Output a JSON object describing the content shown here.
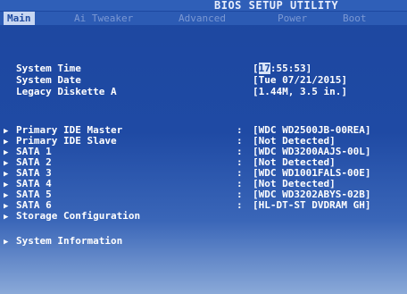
{
  "header": {
    "title": "BIOS SETUP UTILITY"
  },
  "menu": [
    {
      "label": "Main",
      "active": true
    },
    {
      "label": "Ai Tweaker",
      "active": false
    },
    {
      "label": "Advanced",
      "active": false
    },
    {
      "label": "Power",
      "active": false
    },
    {
      "label": "Boot",
      "active": false
    }
  ],
  "system": {
    "time_label": "System Time",
    "time_open": "[",
    "time_cursor": "17",
    "time_rest": ":55:53]",
    "date_label": "System Date",
    "date_value": "[Tue 07/21/2015]",
    "diskette_label": "Legacy Diskette A",
    "diskette_value": "[1.44M, 3.5 in.]"
  },
  "devices": [
    {
      "label": "Primary IDE Master",
      "value": "[WDC WD2500JB-00REA]"
    },
    {
      "label": "Primary IDE Slave",
      "value": "[Not Detected]"
    },
    {
      "label": "SATA 1",
      "value": "[WDC WD3200AAJS-00L]"
    },
    {
      "label": "SATA 2",
      "value": "[Not Detected]"
    },
    {
      "label": "SATA 3",
      "value": "[WDC WD1001FALS-00E]"
    },
    {
      "label": "SATA 4",
      "value": "[Not Detected]"
    },
    {
      "label": "SATA 5",
      "value": "[WDC WD3202ABYS-02B]"
    },
    {
      "label": "SATA 6",
      "value": "[HL-DT-ST DVDRAM GH]"
    }
  ],
  "submenus": {
    "storage": "Storage Configuration",
    "sysinfo": "System Information"
  },
  "glyphs": {
    "arrow": "▶",
    "colon": ":"
  }
}
